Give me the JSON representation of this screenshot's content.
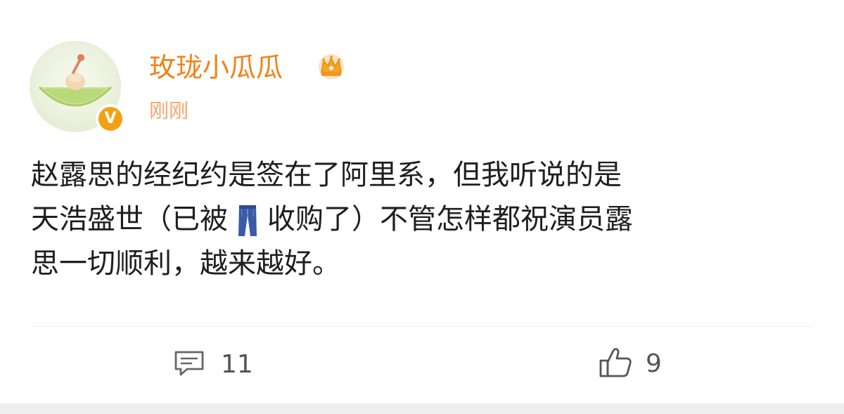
{
  "post": {
    "username": "玫珑小瓜瓜",
    "timestamp": "刚刚",
    "content_lines": [
      "赵露思的经纪约是签在了阿里系，但我听说的是",
      "天浩盛世（已被",
      "收购了）不管怎样都祝演员露",
      "思一切顺利，越来越好。"
    ],
    "verified_badge": "V",
    "icons": {
      "avatar": "melon-slice-avatar",
      "crown": "crown-icon",
      "jeans": "jeans-emoji-icon",
      "comment": "comment-icon",
      "like": "thumbs-up-icon"
    }
  },
  "actions": {
    "comment_count": "11",
    "like_count": "9"
  },
  "colors": {
    "username": "#f18218",
    "timestamp": "#f7a46b",
    "text": "#1e1e1e",
    "badge": "#f2a114"
  }
}
